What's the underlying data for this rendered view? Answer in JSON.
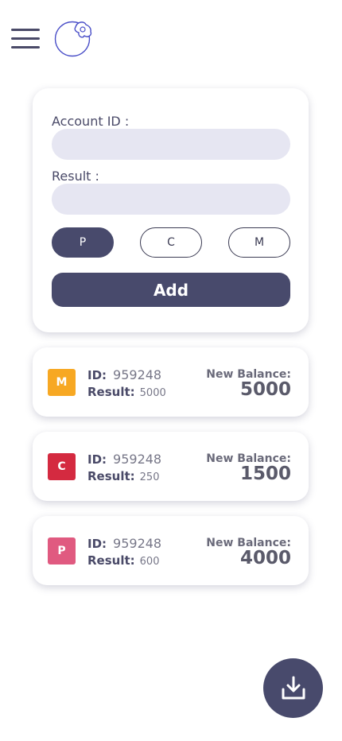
{
  "colors": {
    "primary": "#484a6c",
    "input_bg": "#e6e6f2",
    "badge_m": "#f7a823",
    "badge_c": "#d42a40",
    "badge_p": "#e05a80"
  },
  "header": {
    "menu_icon": "hamburger-menu-icon",
    "logo_icon": "logo-icon"
  },
  "form": {
    "account_label": "Account ID :",
    "account_value": "",
    "result_label": "Result :",
    "result_value": "",
    "types": [
      "P",
      "C",
      "M"
    ],
    "selected_type": "P",
    "add_label": "Add"
  },
  "transactions": [
    {
      "type": "M",
      "id_label": "ID:",
      "id": "959248",
      "result_label": "Result:",
      "result": "5000",
      "balance_label": "New Balance:",
      "balance": "5000"
    },
    {
      "type": "C",
      "id_label": "ID:",
      "id": "959248",
      "result_label": "Result:",
      "result": "250",
      "balance_label": "New Balance:",
      "balance": "1500"
    },
    {
      "type": "P",
      "id_label": "ID:",
      "id": "959248",
      "result_label": "Result:",
      "result": "600",
      "balance_label": "New Balance:",
      "balance": "4000"
    }
  ],
  "fab": {
    "icon": "download-icon"
  }
}
